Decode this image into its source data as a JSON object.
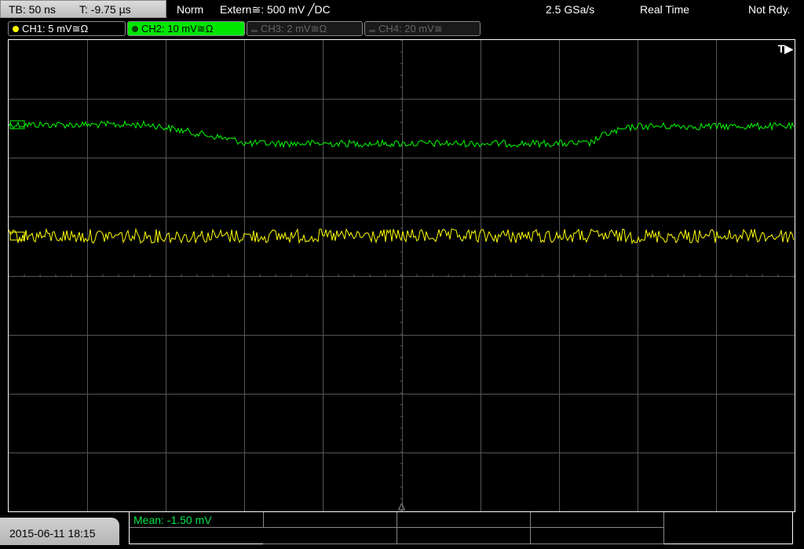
{
  "topbar": {
    "timebase": "TB: 50 ns",
    "trigger_time": "T: -9.75 µs",
    "mode": "Norm",
    "trigger": "Extern≅: 500 mV ╱DC",
    "sample_rate": "2.5 GSa/s",
    "acq": "Real Time",
    "status": "Not Rdy."
  },
  "channels": [
    {
      "label": "CH1: 5 mV≅Ω",
      "active": true,
      "color": "#ffff00"
    },
    {
      "label": "CH2: 10 mV≅Ω",
      "active": true,
      "color": "#00ff00"
    },
    {
      "label": "CH3: 2 mV≅Ω",
      "active": false,
      "color": "#888888"
    },
    {
      "label": "CH4: 20 mV≅",
      "active": false,
      "color": "#888888"
    }
  ],
  "trigger_marker": "T▶",
  "colors": {
    "ch1": "#ffff00",
    "ch2": "#00ff00",
    "grid": "#555555"
  },
  "footer": {
    "datetime": "2015-06-11 18:15",
    "mean": "Mean: -1.50 mV"
  }
}
